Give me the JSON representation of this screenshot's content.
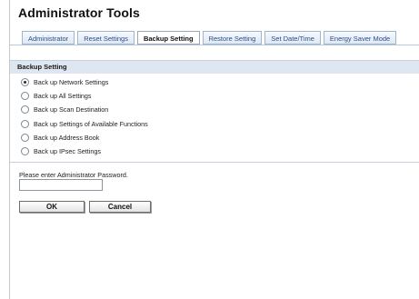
{
  "page": {
    "title": "Administrator Tools"
  },
  "tabs": [
    {
      "label": "Administrator",
      "active": false
    },
    {
      "label": "Reset Settings",
      "active": false
    },
    {
      "label": "Backup Setting",
      "active": true
    },
    {
      "label": "Restore Setting",
      "active": false
    },
    {
      "label": "Set Date/Time",
      "active": false
    },
    {
      "label": "Energy Saver Mode",
      "active": false
    }
  ],
  "section": {
    "title": "Backup Setting"
  },
  "options": [
    {
      "label": "Back up Network Settings",
      "selected": true
    },
    {
      "label": "Back up All Settings",
      "selected": false
    },
    {
      "label": "Back up Scan Destination",
      "selected": false
    },
    {
      "label": "Back up Settings of Available Functions",
      "selected": false
    },
    {
      "label": "Back up Address Book",
      "selected": false
    },
    {
      "label": "Back up IPsec Settings",
      "selected": false
    }
  ],
  "password": {
    "label": "Please enter Administrator Password.",
    "value": ""
  },
  "buttons": {
    "ok": "OK",
    "cancel": "Cancel"
  }
}
